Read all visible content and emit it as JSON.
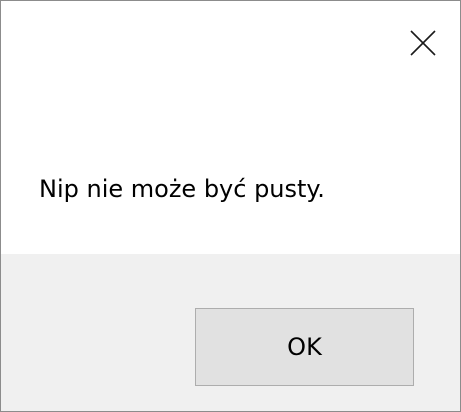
{
  "dialog": {
    "message": "Nip nie może być pusty.",
    "ok_label": "OK",
    "close_icon": "close-icon"
  },
  "colors": {
    "footer_background": "#f0f0f0",
    "button_background": "#e1e1e1",
    "button_border": "#adadad"
  }
}
